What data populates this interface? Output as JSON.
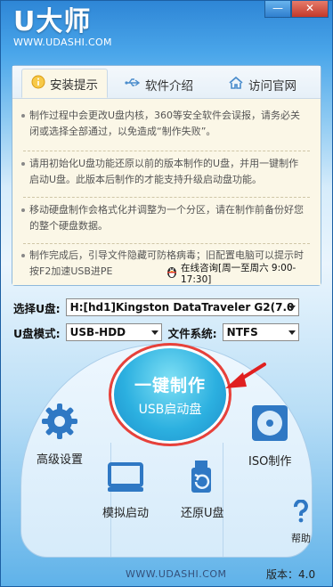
{
  "app": {
    "brand": "U大师",
    "url": "WWW.UDASHI.COM"
  },
  "window_buttons": {
    "minimize": "—",
    "close": "✕"
  },
  "tabs": [
    {
      "label": "安装提示",
      "icon": "info-icon",
      "active": true
    },
    {
      "label": "软件介绍",
      "icon": "usb-icon",
      "active": false
    },
    {
      "label": "访问官网",
      "icon": "home-icon",
      "active": false
    }
  ],
  "tips": [
    "制作过程中会更改U盘内核，360等安全软件会误报，请务必关闭或选择全部通过，以免造成“制作失败”。",
    "请用初始化U盘功能还原以前的版本制作的U盘，并用一键制作启动U盘。此版本后制作的才能支持升级启动盘功能。",
    "移动硬盘制作会格式化并调整为一个分区，请在制作前备份好您的整个硬盘数据。",
    "制作完成后，引导文件隐藏可防格病毒；旧配置电脑可以提示时按F2加速USB进PE"
  ],
  "qq_consult": "在线咨询[周一至周六 9:00-17:30]",
  "form": {
    "disk_label": "选择U盘:",
    "disk_value": "H:[hd1]Kingston DataTraveler G2(7.0",
    "mode_label": "U盘模式:",
    "mode_value": "USB-HDD",
    "fs_label": "文件系统:",
    "fs_value": "NTFS"
  },
  "make_button": {
    "line1": "一键制作",
    "line2": "USB启动盘"
  },
  "tools": {
    "advanced": "高级设置",
    "iso": "ISO制作",
    "simulate": "模拟启动",
    "restore": "还原U盘",
    "help": "帮助"
  },
  "footer": {
    "site": "WWW.UDASHI.COM",
    "version": "版本：4.0"
  },
  "colors": {
    "accent": "#2cb0e0",
    "highlight_ring": "#e8413a",
    "title_bar": "#2e86d6"
  }
}
